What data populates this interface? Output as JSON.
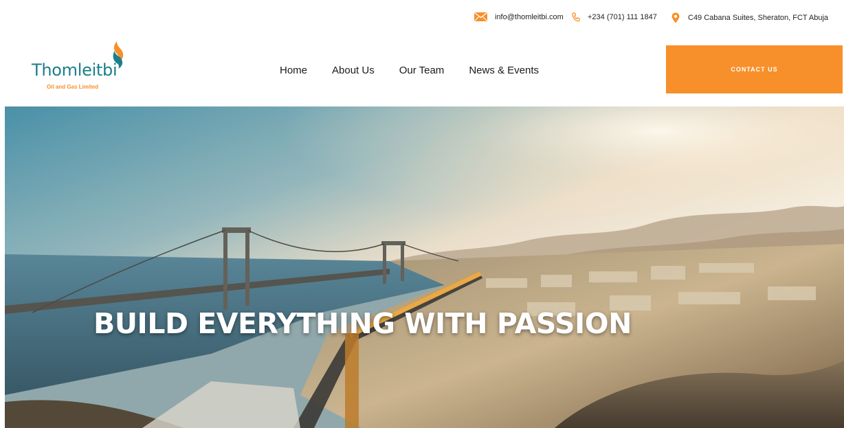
{
  "topbar": {
    "email": "info@thomleitbi.com",
    "phone": "+234 (701) 111 1847",
    "address": "C49 Cabana Suites, Sheraton, FCT Abuja",
    "icons": {
      "email": "envelope-icon",
      "phone": "phone-icon",
      "address": "map-pin-icon"
    }
  },
  "brand": {
    "name": "Thomleitbi",
    "tagline": "Oil and Gas Limited",
    "primary_color": "#1b7f8a",
    "accent_color": "#f7902a"
  },
  "nav": {
    "items": [
      {
        "label": "Home"
      },
      {
        "label": "About Us"
      },
      {
        "label": "Our Team"
      },
      {
        "label": "News & Events"
      }
    ],
    "cta_label": "CONTACT US"
  },
  "hero": {
    "title": "BUILD EVERYTHING WITH PASSION",
    "image": "aerial-construction-crane-city-river"
  }
}
